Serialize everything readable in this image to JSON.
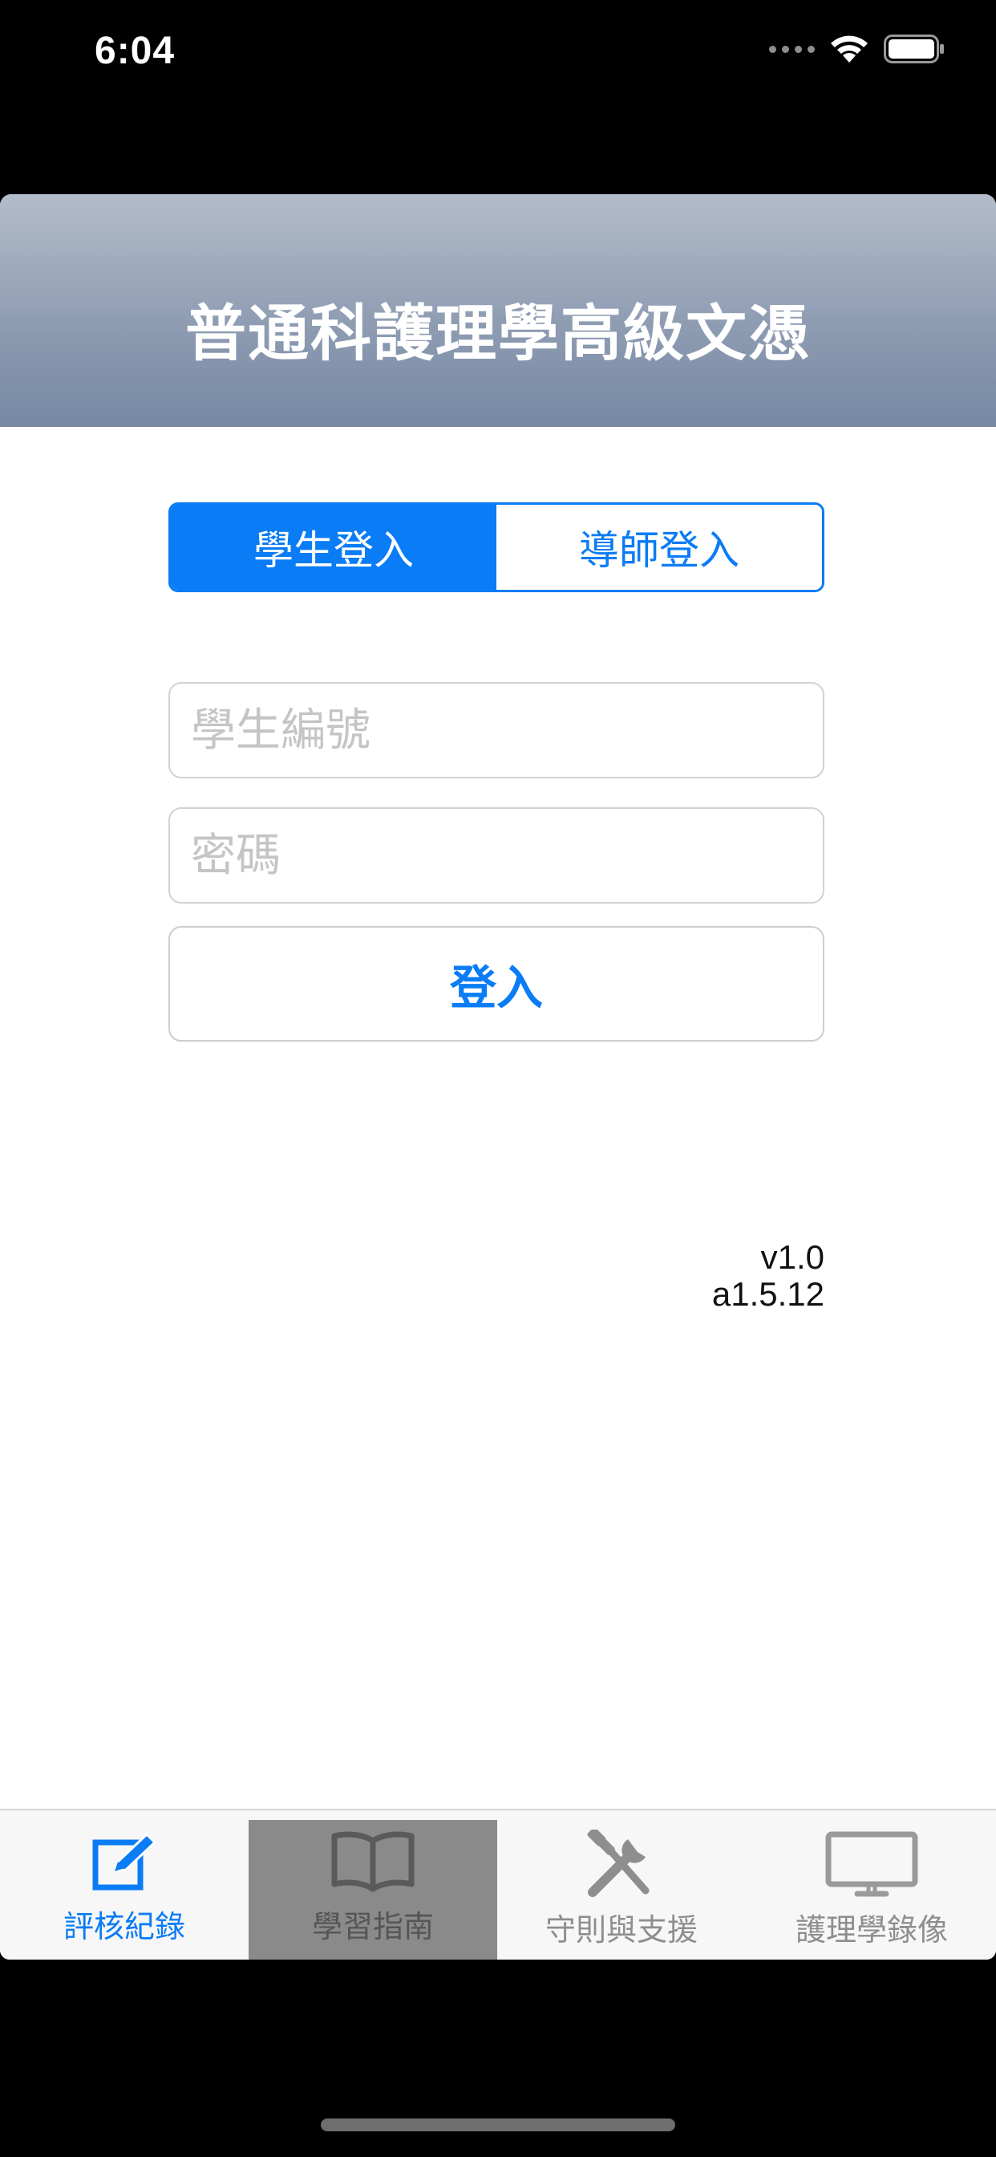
{
  "status_bar": {
    "time": "6:04"
  },
  "header": {
    "title": "普通科護理學高級文憑"
  },
  "login_mode": {
    "tabs": [
      {
        "label": "學生登入",
        "selected": true
      },
      {
        "label": "導師登入",
        "selected": false
      }
    ]
  },
  "form": {
    "student_id": {
      "placeholder": "學生編號",
      "value": ""
    },
    "password": {
      "placeholder": "密碼",
      "value": ""
    },
    "submit_label": "登入"
  },
  "version": {
    "app": "v1.0",
    "build": "a1.5.12"
  },
  "tabbar": {
    "items": [
      {
        "label": "評核紀錄",
        "icon": "edit-icon",
        "state": "selected"
      },
      {
        "label": "學習指南",
        "icon": "book-icon",
        "state": "highlighted"
      },
      {
        "label": "守則與支援",
        "icon": "tools-icon",
        "state": "normal"
      },
      {
        "label": "護理學錄像",
        "icon": "monitor-icon",
        "state": "normal"
      }
    ]
  },
  "colors": {
    "accent": "#0a7cf5",
    "header_top": "#b3bcca",
    "header_bottom": "#7587a2"
  }
}
